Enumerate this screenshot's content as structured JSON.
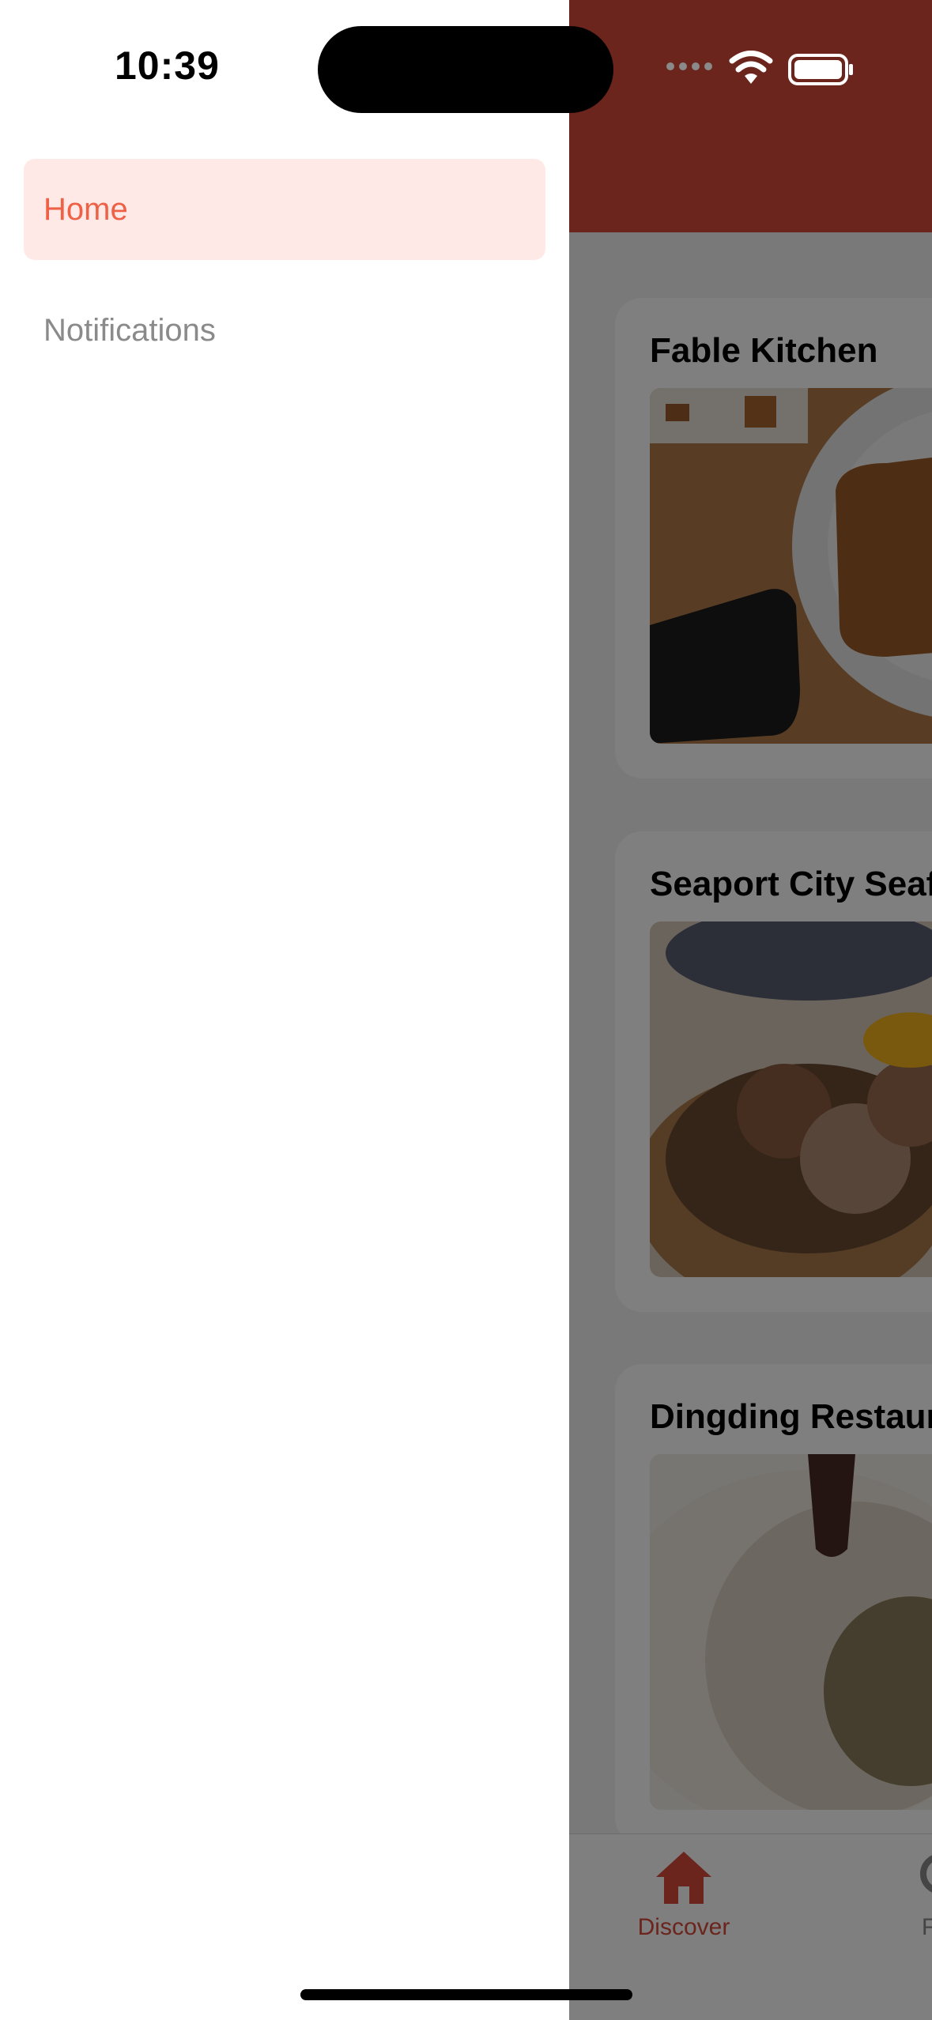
{
  "status_bar": {
    "time": "10:39"
  },
  "drawer": {
    "items": [
      {
        "label": "Home",
        "active": true
      },
      {
        "label": "Notifications",
        "active": false
      }
    ]
  },
  "feed": {
    "restaurants": [
      {
        "name": "Fable Kitchen",
        "image": "toast-on-plate-photo"
      },
      {
        "name": "Seaport City Seafood",
        "image": "braised-meat-dish-photo"
      },
      {
        "name": "Dingding Restaurant",
        "image": "dumpling-photo"
      }
    ]
  },
  "tab_bar": {
    "tabs": [
      {
        "label": "Discover",
        "icon": "home-icon",
        "active": true
      },
      {
        "label": "Find",
        "icon": "search-icon",
        "active": false
      }
    ]
  },
  "colors": {
    "brand_red": "#d64a38",
    "drawer_active_bg": "#ffe9e6",
    "drawer_active_text": "#ef6146",
    "drawer_inactive_text": "#8a8a8a"
  }
}
